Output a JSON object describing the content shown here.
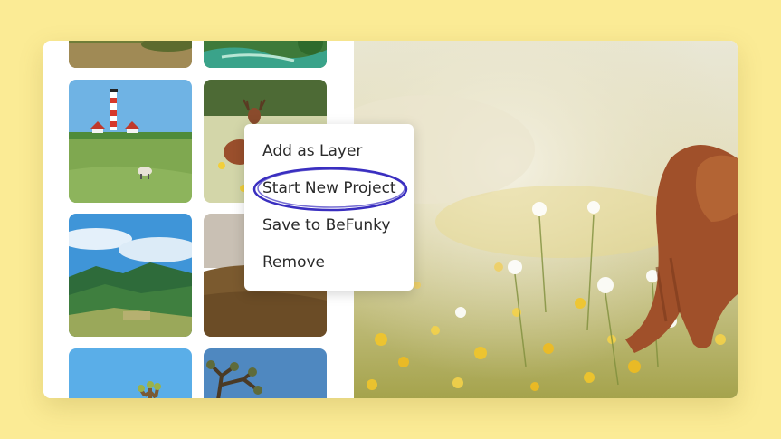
{
  "context_menu": {
    "items": [
      {
        "label": "Add as Layer"
      },
      {
        "label": "Start New Project"
      },
      {
        "label": "Save to BeFunky"
      },
      {
        "label": "Remove"
      }
    ],
    "highlighted_item": "Start New Project"
  },
  "colors": {
    "page_background": "#fbeb95",
    "annotation_ring": "#3a2fc0",
    "menu_background": "#ffffff",
    "menu_text": "#2a2a2a"
  },
  "sidebar": {
    "thumbnails": [
      {
        "subject": "grass-field"
      },
      {
        "subject": "river-stream"
      },
      {
        "subject": "lighthouse-meadow"
      },
      {
        "subject": "deer-in-flowers"
      },
      {
        "subject": "green-mountains"
      },
      {
        "subject": "brown-hills"
      },
      {
        "subject": "cactus-sky"
      },
      {
        "subject": "tree-sky"
      }
    ]
  },
  "main_photo": {
    "subject": "deer-in-wildflower-meadow"
  }
}
